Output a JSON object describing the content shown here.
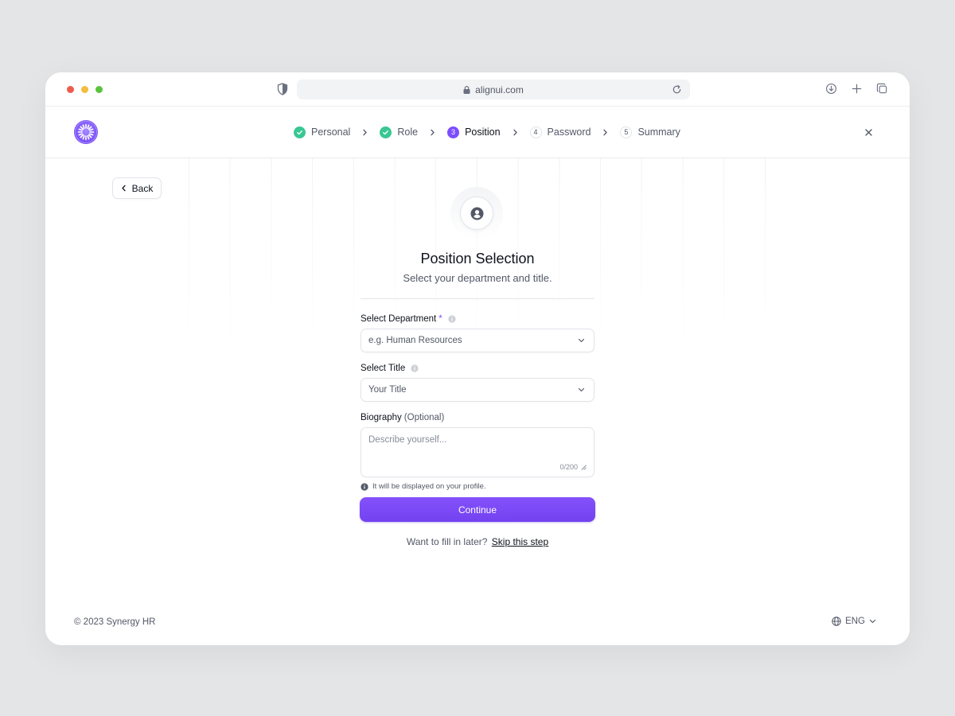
{
  "browser": {
    "url": "alignui.com",
    "traffic_lights": [
      "#ee5b4f",
      "#f4bd3f",
      "#5cc33f"
    ]
  },
  "stepper": {
    "steps": [
      {
        "number": "",
        "label": "Personal",
        "state": "done"
      },
      {
        "number": "",
        "label": "Role",
        "state": "done"
      },
      {
        "number": "3",
        "label": "Position",
        "state": "active"
      },
      {
        "number": "4",
        "label": "Password",
        "state": "todo"
      },
      {
        "number": "5",
        "label": "Summary",
        "state": "todo"
      }
    ]
  },
  "back_label": "Back",
  "page": {
    "title": "Position Selection",
    "subtitle": "Select your department and title."
  },
  "form": {
    "department": {
      "label": "Select Department",
      "required_mark": "*",
      "placeholder": "e.g. Human Resources"
    },
    "title": {
      "label": "Select Title",
      "placeholder": "Your Title"
    },
    "biography": {
      "label": "Biography",
      "optional": "(Optional)",
      "placeholder": "Describe yourself...",
      "counter": "0/200",
      "hint": "It will be displayed on your profile."
    }
  },
  "continue_label": "Continue",
  "skip": {
    "prompt": "Want to fill in later?",
    "link": "Skip this step"
  },
  "footer": {
    "copyright": "© 2023 Synergy HR",
    "language": "ENG"
  },
  "colors": {
    "accent": "#7c4dff",
    "success": "#38c793"
  }
}
